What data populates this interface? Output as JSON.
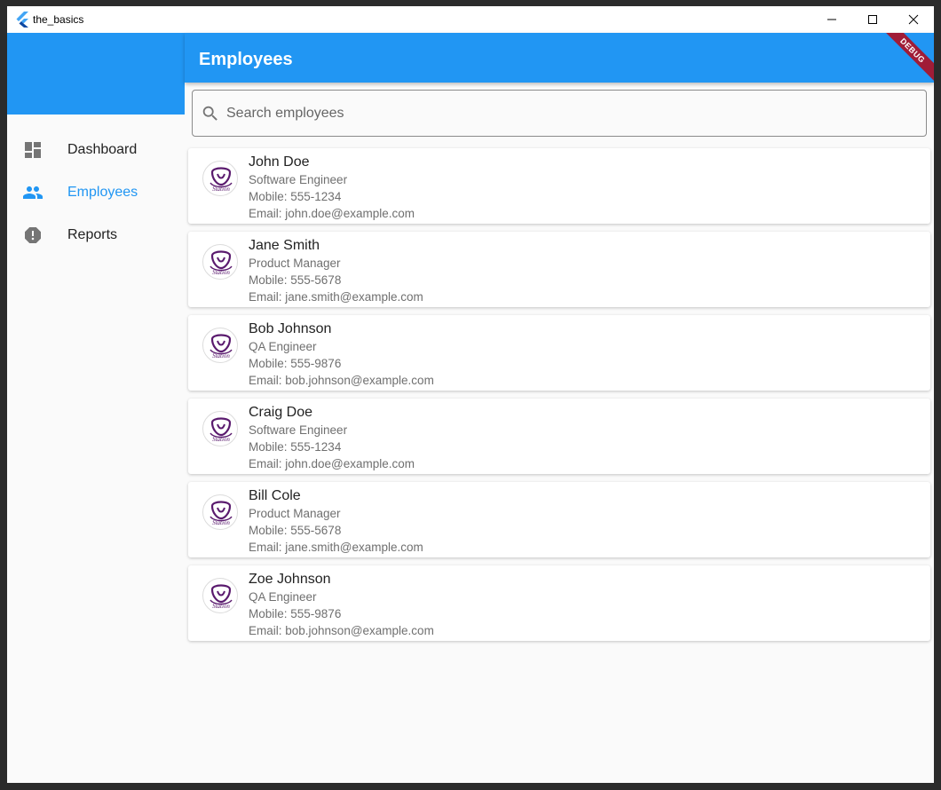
{
  "window": {
    "title": "the_basics"
  },
  "sidebar": {
    "items": [
      {
        "label": "Dashboard",
        "icon": "dashboard-icon",
        "active": false
      },
      {
        "label": "Employees",
        "icon": "people-icon",
        "active": true
      },
      {
        "label": "Reports",
        "icon": "report-icon",
        "active": false
      }
    ]
  },
  "appbar": {
    "title": "Employees",
    "debug_label": "DEBUG"
  },
  "search": {
    "placeholder": "Search employees",
    "value": ""
  },
  "employees": [
    {
      "name": "John Doe",
      "title": "Software Engineer",
      "mobile": "Mobile: 555-1234",
      "email": "Email: john.doe@example.com"
    },
    {
      "name": "Jane Smith",
      "title": "Product Manager",
      "mobile": "Mobile: 555-5678",
      "email": "Email: jane.smith@example.com"
    },
    {
      "name": "Bob Johnson",
      "title": "QA Engineer",
      "mobile": "Mobile: 555-9876",
      "email": "Email: bob.johnson@example.com"
    },
    {
      "name": "Craig Doe",
      "title": "Software Engineer",
      "mobile": "Mobile: 555-1234",
      "email": "Email: john.doe@example.com"
    },
    {
      "name": "Bill Cole",
      "title": "Product Manager",
      "mobile": "Mobile: 555-5678",
      "email": "Email: jane.smith@example.com"
    },
    {
      "name": "Zoe Johnson",
      "title": "QA Engineer",
      "mobile": "Mobile: 555-9876",
      "email": "Email: bob.johnson@example.com"
    }
  ],
  "avatar_logo_text": "Station",
  "colors": {
    "primary": "#2196f3",
    "debug_banner": "#a01c37",
    "avatar_purple": "#5a1a6e"
  }
}
